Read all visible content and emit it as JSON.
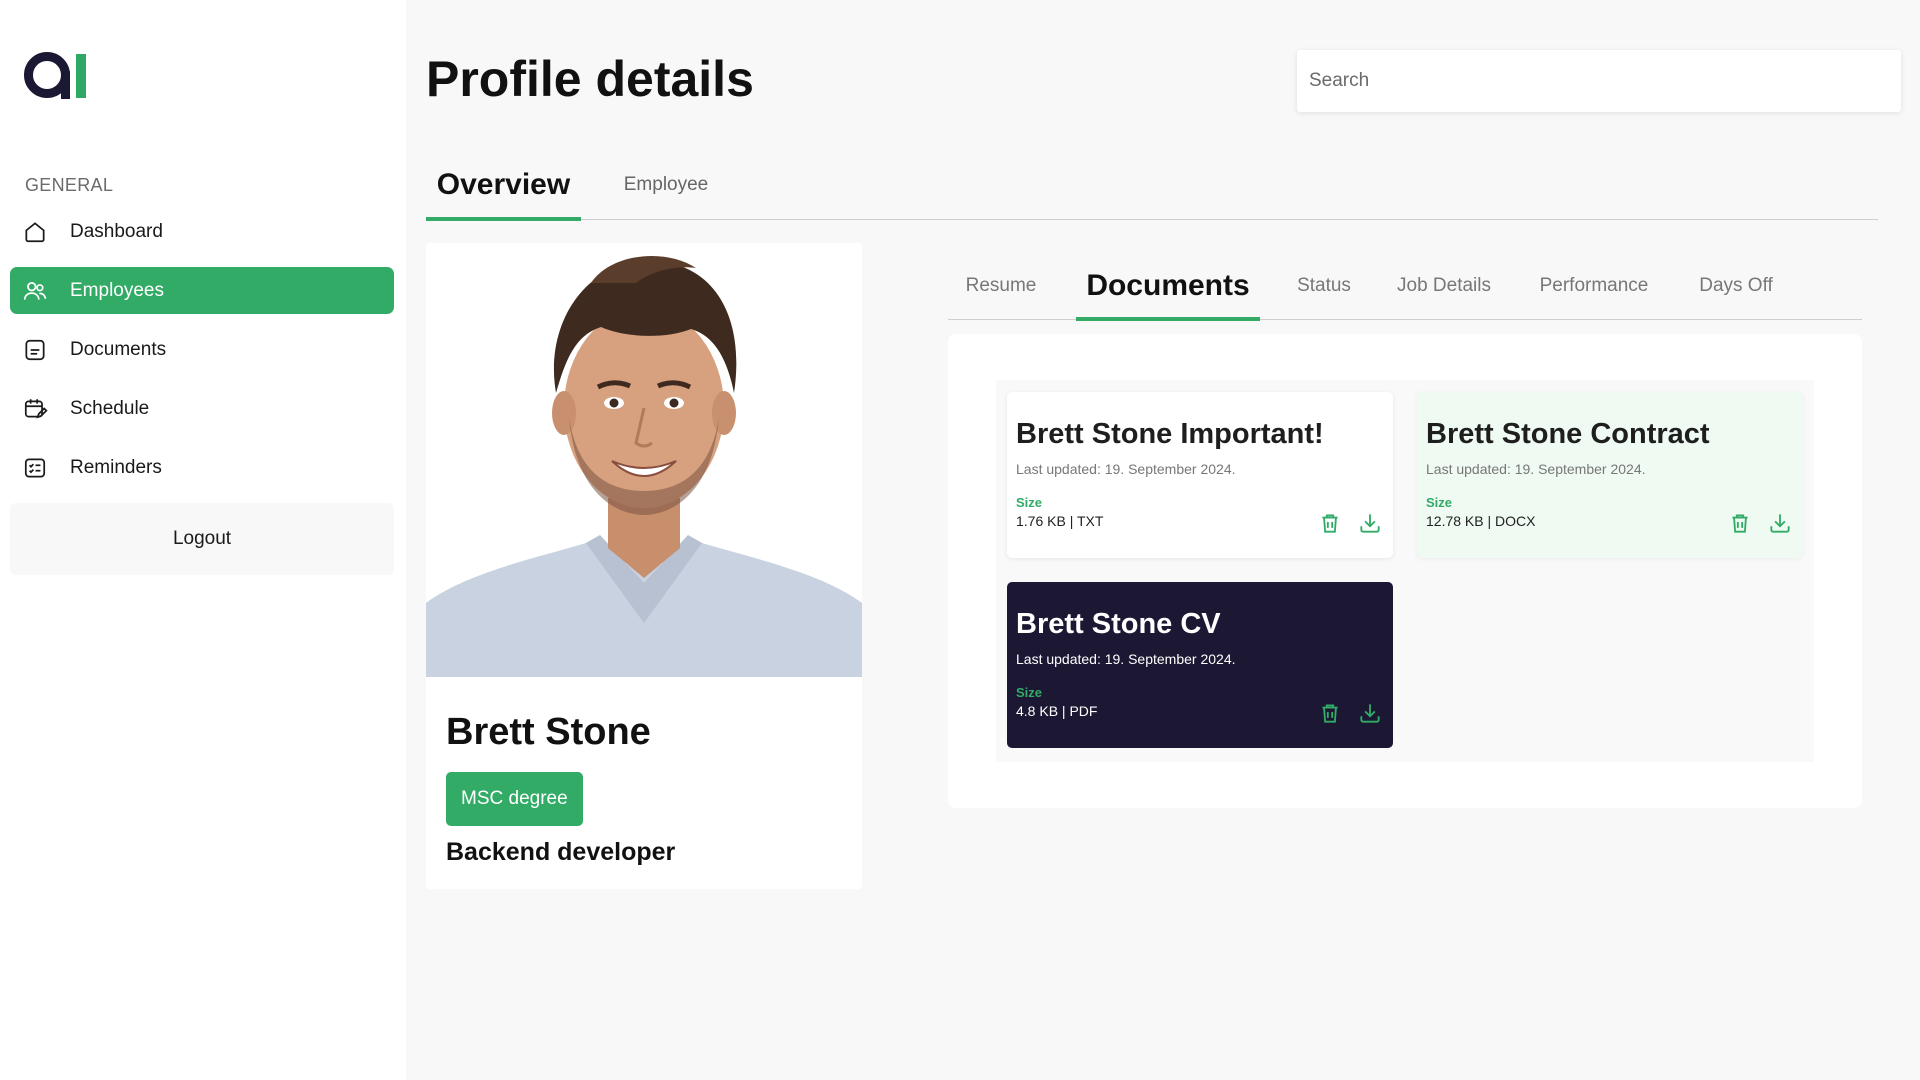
{
  "sidebar": {
    "section_label": "GENERAL",
    "items": [
      {
        "label": "Dashboard",
        "icon": "home-icon"
      },
      {
        "label": "Employees",
        "icon": "users-icon",
        "active": true
      },
      {
        "label": "Documents",
        "icon": "document-icon"
      },
      {
        "label": "Schedule",
        "icon": "calendar-edit-icon"
      },
      {
        "label": "Reminders",
        "icon": "checklist-icon"
      }
    ],
    "logout_label": "Logout"
  },
  "header": {
    "title": "Profile details",
    "search_placeholder": "Search"
  },
  "main_tabs": [
    {
      "label": "Overview",
      "active": true
    },
    {
      "label": "Employee",
      "active": false
    }
  ],
  "profile": {
    "name": "Brett Stone",
    "degree": "MSC degree",
    "role": "Backend developer"
  },
  "sub_tabs": [
    {
      "label": "Resume"
    },
    {
      "label": "Documents",
      "active": true
    },
    {
      "label": "Status"
    },
    {
      "label": "Job Details"
    },
    {
      "label": "Performance"
    },
    {
      "label": "Days Off"
    }
  ],
  "documents": [
    {
      "title": "Brett Stone Important!",
      "updated": "Last updated: 19. September 2024.",
      "size_label": "Size",
      "size": "1.76 KB | TXT",
      "style": "light"
    },
    {
      "title": "Brett Stone Contract",
      "updated": "Last updated: 19. September 2024.",
      "size_label": "Size",
      "size": "12.78 KB | DOCX",
      "style": "mint"
    },
    {
      "title": "Brett Stone CV",
      "updated": "Last updated: 19. September 2024.",
      "size_label": "Size",
      "size": "4.8 KB | PDF",
      "style": "dark"
    }
  ],
  "colors": {
    "accent": "#32ab67",
    "dark_card": "#1c1834",
    "mint_card": "#eefaf2",
    "logo_dark": "#1b1833"
  }
}
